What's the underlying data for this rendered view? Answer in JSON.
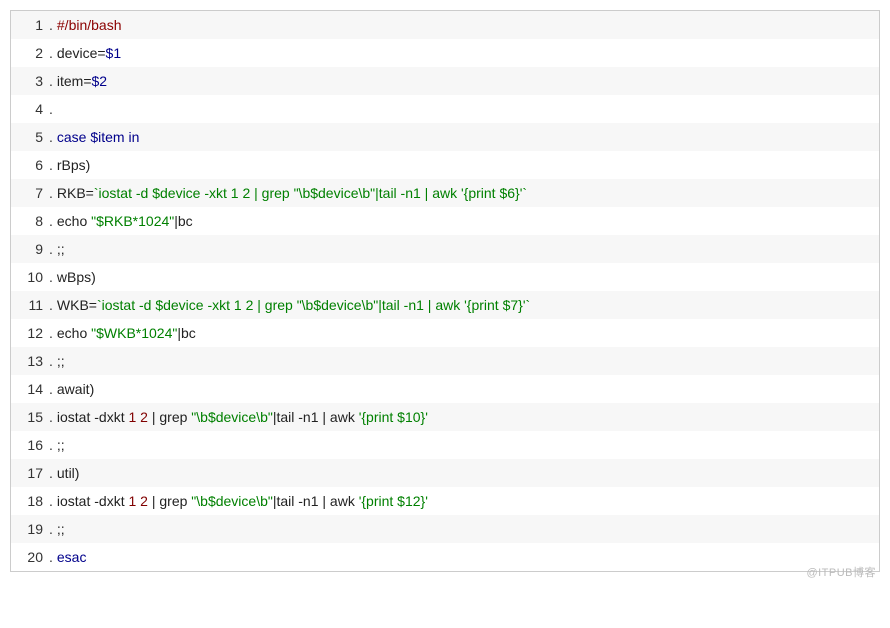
{
  "watermark": "@ITPUB博客",
  "lines": [
    {
      "n": "1",
      "tokens": [
        {
          "cls": "tok-shebang",
          "t": "#/bin/bash"
        }
      ]
    },
    {
      "n": "2",
      "tokens": [
        {
          "cls": "tok-plain",
          "t": "device="
        },
        {
          "cls": "tok-var",
          "t": "$1"
        }
      ]
    },
    {
      "n": "3",
      "tokens": [
        {
          "cls": "tok-plain",
          "t": "item="
        },
        {
          "cls": "tok-var",
          "t": "$2"
        }
      ]
    },
    {
      "n": "4",
      "tokens": [
        {
          "cls": "tok-plain",
          "t": ""
        }
      ]
    },
    {
      "n": "5",
      "tokens": [
        {
          "cls": "tok-kw",
          "t": "case"
        },
        {
          "cls": "tok-plain",
          "t": " "
        },
        {
          "cls": "tok-var",
          "t": "$item"
        },
        {
          "cls": "tok-plain",
          "t": " "
        },
        {
          "cls": "tok-kw",
          "t": "in"
        }
      ]
    },
    {
      "n": "6",
      "tokens": [
        {
          "cls": "tok-plain",
          "t": "rBps)"
        }
      ]
    },
    {
      "n": "7",
      "tokens": [
        {
          "cls": "tok-plain",
          "t": "RKB="
        },
        {
          "cls": "tok-str",
          "t": "`iostat -d $device -xkt 1 2 | grep \"\\b$device\\b\"|tail -n1 | awk '{print $6}'`"
        }
      ]
    },
    {
      "n": "8",
      "tokens": [
        {
          "cls": "tok-plain",
          "t": "echo "
        },
        {
          "cls": "tok-str",
          "t": "\"$RKB*1024\""
        },
        {
          "cls": "tok-plain",
          "t": "|bc"
        }
      ]
    },
    {
      "n": "9",
      "tokens": [
        {
          "cls": "tok-plain",
          "t": ";;"
        }
      ]
    },
    {
      "n": "10",
      "tokens": [
        {
          "cls": "tok-plain",
          "t": "wBps)"
        }
      ]
    },
    {
      "n": "11",
      "tokens": [
        {
          "cls": "tok-plain",
          "t": "WKB="
        },
        {
          "cls": "tok-str",
          "t": "`iostat -d $device -xkt 1 2 | grep \"\\b$device\\b\"|tail -n1 | awk '{print $7}'`"
        }
      ]
    },
    {
      "n": "12",
      "tokens": [
        {
          "cls": "tok-plain",
          "t": "echo "
        },
        {
          "cls": "tok-str",
          "t": "\"$WKB*1024\""
        },
        {
          "cls": "tok-plain",
          "t": "|bc"
        }
      ]
    },
    {
      "n": "13",
      "tokens": [
        {
          "cls": "tok-plain",
          "t": ";;"
        }
      ]
    },
    {
      "n": "14",
      "tokens": [
        {
          "cls": "tok-plain",
          "t": "await)"
        }
      ]
    },
    {
      "n": "15",
      "tokens": [
        {
          "cls": "tok-plain",
          "t": "iostat -dxkt "
        },
        {
          "cls": "tok-num",
          "t": "1"
        },
        {
          "cls": "tok-plain",
          "t": " "
        },
        {
          "cls": "tok-num",
          "t": "2"
        },
        {
          "cls": "tok-plain",
          "t": " | grep "
        },
        {
          "cls": "tok-str",
          "t": "\"\\b$device\\b\""
        },
        {
          "cls": "tok-plain",
          "t": "|tail -n1 | awk "
        },
        {
          "cls": "tok-str",
          "t": "'{print $10}'"
        }
      ]
    },
    {
      "n": "16",
      "tokens": [
        {
          "cls": "tok-plain",
          "t": ";;"
        }
      ]
    },
    {
      "n": "17",
      "tokens": [
        {
          "cls": "tok-plain",
          "t": "util)"
        }
      ]
    },
    {
      "n": "18",
      "tokens": [
        {
          "cls": "tok-plain",
          "t": "iostat -dxkt "
        },
        {
          "cls": "tok-num",
          "t": "1"
        },
        {
          "cls": "tok-plain",
          "t": " "
        },
        {
          "cls": "tok-num",
          "t": "2"
        },
        {
          "cls": "tok-plain",
          "t": " | grep "
        },
        {
          "cls": "tok-str",
          "t": "\"\\b$device\\b\""
        },
        {
          "cls": "tok-plain",
          "t": "|tail -n1 | awk "
        },
        {
          "cls": "tok-str",
          "t": "'{print $12}'"
        }
      ]
    },
    {
      "n": "19",
      "tokens": [
        {
          "cls": "tok-plain",
          "t": ";;"
        }
      ]
    },
    {
      "n": "20",
      "tokens": [
        {
          "cls": "tok-kw",
          "t": "esac"
        }
      ]
    }
  ]
}
